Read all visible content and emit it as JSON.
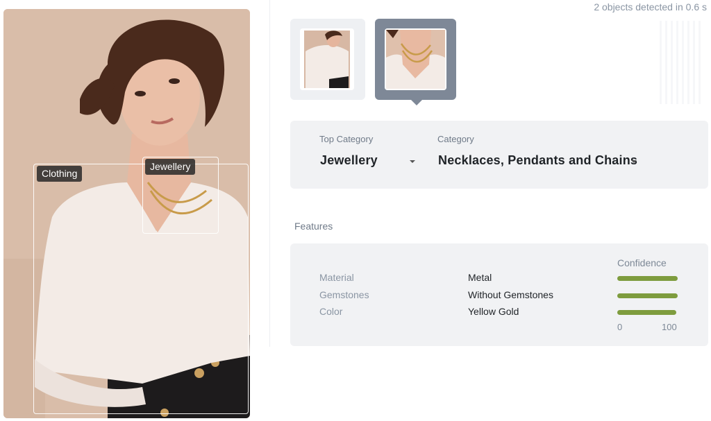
{
  "header": {
    "detected_text": "2 objects detected in 0.6 s"
  },
  "photo": {
    "detections": [
      {
        "label": "Clothing"
      },
      {
        "label": "Jewellery"
      }
    ]
  },
  "thumbnails": [
    {
      "name": "clothing-thumbnail",
      "selected": false
    },
    {
      "name": "jewellery-thumbnail",
      "selected": true
    }
  ],
  "category": {
    "top_category_label": "Top Category",
    "top_category_value": "Jewellery",
    "category_label": "Category",
    "category_value": "Necklaces, Pendants and Chains"
  },
  "features": {
    "title": "Features",
    "confidence_label": "Confidence",
    "axis_min": "0",
    "axis_max": "100",
    "rows": [
      {
        "name": "Material",
        "value": "Metal",
        "confidence": 99
      },
      {
        "name": "Gemstones",
        "value": "Without Gemstones",
        "confidence": 99
      },
      {
        "name": "Color",
        "value": "Yellow Gold",
        "confidence": 97
      }
    ]
  },
  "colors": {
    "accent_bar": "#7e9c3e",
    "selected_thumb": "#7e8897",
    "card_bg": "#f1f2f4"
  }
}
